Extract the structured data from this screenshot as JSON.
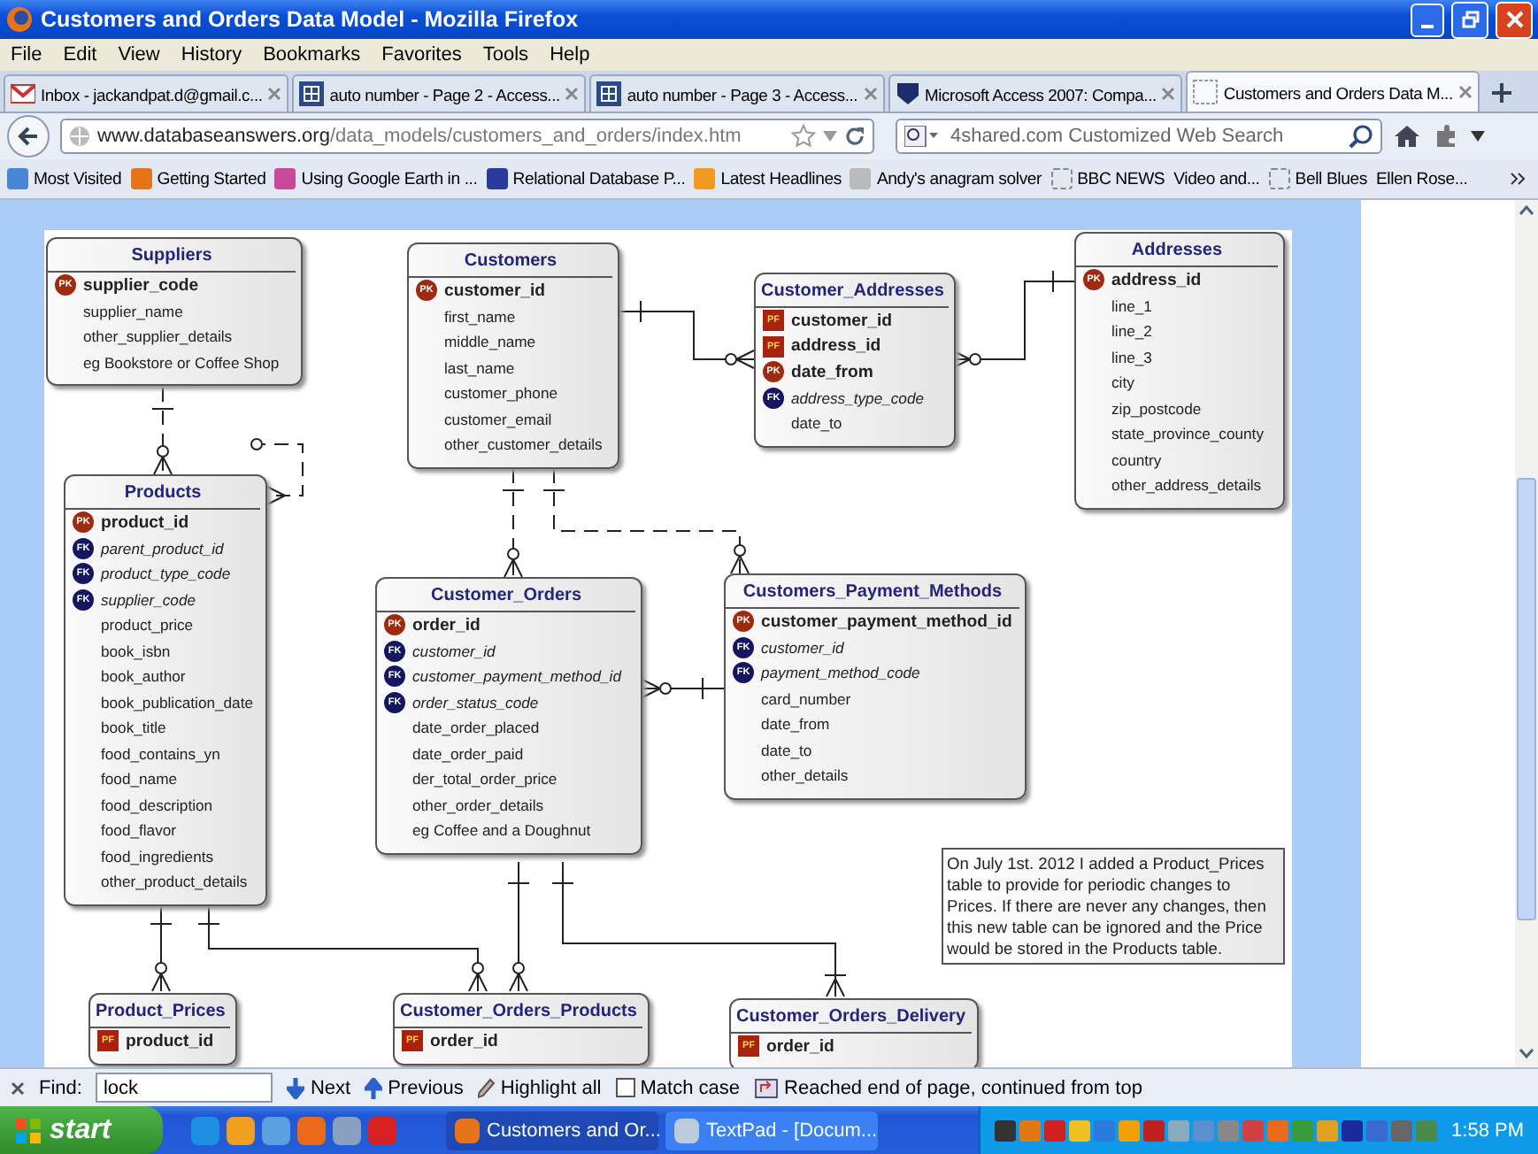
{
  "window": {
    "title": "Customers and Orders Data Model - Mozilla Firefox"
  },
  "menu": [
    "File",
    "Edit",
    "View",
    "History",
    "Bookmarks",
    "Favorites",
    "Tools",
    "Help"
  ],
  "tabs": [
    {
      "label": "Inbox - jackandpat.d@gmail.c...",
      "selected": false
    },
    {
      "label": "auto number - Page 2 - Access...",
      "selected": false
    },
    {
      "label": "auto number - Page 3 - Access...",
      "selected": false
    },
    {
      "label": "Microsoft Access 2007: Compa...",
      "selected": false
    },
    {
      "label": "Customers and Orders Data M...",
      "selected": true
    }
  ],
  "address_bar": {
    "url": "www.databaseanswers.org/data_models/customers_and_orders/index.htm"
  },
  "search": {
    "placeholder": "4shared.com Customized Web Search"
  },
  "bookmarks": [
    "Most Visited",
    "Getting Started",
    "Using Google Earth in ...",
    "Relational Database P...",
    "Latest Headlines",
    "Andy's anagram solver",
    "BBC NEWS",
    "Video and...",
    "Bell Blues",
    "Ellen Rose..."
  ],
  "diagram": {
    "entities": [
      {
        "name": "Suppliers",
        "attributes": [
          {
            "name": "supplier_code",
            "key": "PK"
          },
          {
            "name": "supplier_name"
          },
          {
            "name": "other_supplier_details"
          },
          {
            "name": "eg Bookstore or Coffee Shop"
          }
        ]
      },
      {
        "name": "Customers",
        "attributes": [
          {
            "name": "customer_id",
            "key": "PK"
          },
          {
            "name": "first_name"
          },
          {
            "name": "middle_name"
          },
          {
            "name": "last_name"
          },
          {
            "name": "customer_phone"
          },
          {
            "name": "customer_email"
          },
          {
            "name": "other_customer_details"
          }
        ]
      },
      {
        "name": "Customer_Addresses",
        "attributes": [
          {
            "name": "customer_id",
            "key": "PF"
          },
          {
            "name": "address_id",
            "key": "PF"
          },
          {
            "name": "date_from",
            "key": "PK"
          },
          {
            "name": "address_type_code",
            "key": "FK"
          },
          {
            "name": "date_to"
          }
        ]
      },
      {
        "name": "Addresses",
        "attributes": [
          {
            "name": "address_id",
            "key": "PK"
          },
          {
            "name": "line_1"
          },
          {
            "name": "line_2"
          },
          {
            "name": "line_3"
          },
          {
            "name": "city"
          },
          {
            "name": "zip_postcode"
          },
          {
            "name": "state_province_county"
          },
          {
            "name": "country"
          },
          {
            "name": "other_address_details"
          }
        ]
      },
      {
        "name": "Products",
        "attributes": [
          {
            "name": "product_id",
            "key": "PK"
          },
          {
            "name": "parent_product_id",
            "key": "FK"
          },
          {
            "name": "product_type_code",
            "key": "FK"
          },
          {
            "name": "supplier_code",
            "key": "FK"
          },
          {
            "name": "product_price"
          },
          {
            "name": "book_isbn"
          },
          {
            "name": "book_author"
          },
          {
            "name": "book_publication_date"
          },
          {
            "name": "book_title"
          },
          {
            "name": "food_contains_yn"
          },
          {
            "name": "food_name"
          },
          {
            "name": "food_description"
          },
          {
            "name": "food_flavor"
          },
          {
            "name": "food_ingredients"
          },
          {
            "name": "other_product_details"
          }
        ]
      },
      {
        "name": "Customer_Orders",
        "attributes": [
          {
            "name": "order_id",
            "key": "PK"
          },
          {
            "name": "customer_id",
            "key": "FK"
          },
          {
            "name": "customer_payment_method_id",
            "key": "FK"
          },
          {
            "name": "order_status_code",
            "key": "FK"
          },
          {
            "name": "date_order_placed"
          },
          {
            "name": "date_order_paid"
          },
          {
            "name": "der_total_order_price"
          },
          {
            "name": "other_order_details"
          },
          {
            "name": "eg Coffee and a Doughnut"
          }
        ]
      },
      {
        "name": "Customers_Payment_Methods",
        "attributes": [
          {
            "name": "customer_payment_method_id",
            "key": "PK"
          },
          {
            "name": "customer_id",
            "key": "FK"
          },
          {
            "name": "payment_method_code",
            "key": "FK"
          },
          {
            "name": "card_number"
          },
          {
            "name": "date_from"
          },
          {
            "name": "date_to"
          },
          {
            "name": "other_details"
          }
        ]
      },
      {
        "name": "Product_Prices",
        "attributes": [
          {
            "name": "product_id",
            "key": "PF"
          }
        ]
      },
      {
        "name": "Customer_Orders_Products",
        "attributes": [
          {
            "name": "order_id",
            "key": "PF"
          }
        ]
      },
      {
        "name": "Customer_Orders_Delivery",
        "attributes": [
          {
            "name": "order_id",
            "key": "PF"
          }
        ]
      }
    ],
    "note": "On July 1st. 2012 I added a Product_Prices table to provide for periodic changes to Prices. If there are never any changes, then this new table can be ignored and the Price would be stored in the Products table."
  },
  "find_bar": {
    "label": "Find:",
    "value": "lock",
    "next": "Next",
    "previous": "Previous",
    "highlight": "Highlight all",
    "match_case": {
      "label": "Match case",
      "checked": false
    },
    "message": "Reached end of page, continued from top"
  },
  "taskbar": {
    "start": "start",
    "tasks": [
      {
        "label": "Customers and Or...",
        "selected": true
      },
      {
        "label": "TextPad - [Docum...",
        "selected": false
      }
    ],
    "clock": "1:58 PM"
  }
}
